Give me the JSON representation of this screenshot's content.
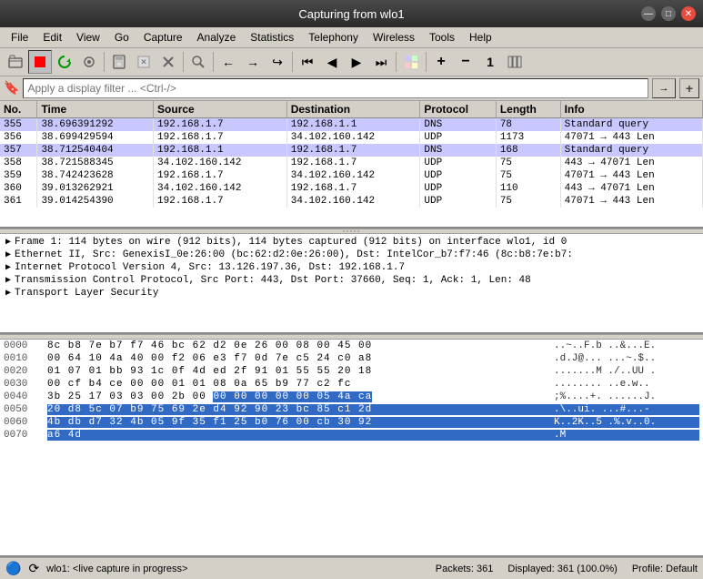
{
  "titlebar": {
    "title": "Capturing from wlo1",
    "min_label": "—",
    "max_label": "□",
    "close_label": "✕"
  },
  "menubar": {
    "items": [
      {
        "label": "File",
        "id": "file"
      },
      {
        "label": "Edit",
        "id": "edit"
      },
      {
        "label": "View",
        "id": "view"
      },
      {
        "label": "Go",
        "id": "go"
      },
      {
        "label": "Capture",
        "id": "capture"
      },
      {
        "label": "Analyze",
        "id": "analyze"
      },
      {
        "label": "Statistics",
        "id": "statistics"
      },
      {
        "label": "Telephony",
        "id": "telephony"
      },
      {
        "label": "Wireless",
        "id": "wireless"
      },
      {
        "label": "Tools",
        "id": "tools"
      },
      {
        "label": "Help",
        "id": "help"
      }
    ]
  },
  "toolbar": {
    "buttons": [
      {
        "id": "open",
        "icon": "📂",
        "tooltip": "Open"
      },
      {
        "id": "stop",
        "icon": "⏹",
        "tooltip": "Stop",
        "color": "red"
      },
      {
        "id": "restart",
        "icon": "🔄",
        "tooltip": "Restart"
      },
      {
        "id": "options",
        "icon": "⚙",
        "tooltip": "Options"
      },
      {
        "id": "save",
        "icon": "💾",
        "tooltip": "Save"
      },
      {
        "id": "close",
        "icon": "📋",
        "tooltip": "Close"
      },
      {
        "id": "export",
        "icon": "✖",
        "tooltip": "Export"
      },
      {
        "id": "find",
        "icon": "🔍",
        "tooltip": "Find"
      },
      {
        "id": "back",
        "icon": "←",
        "tooltip": "Back"
      },
      {
        "id": "forward",
        "icon": "→",
        "tooltip": "Forward"
      },
      {
        "id": "jump",
        "icon": "↪",
        "tooltip": "Jump"
      },
      {
        "id": "first",
        "icon": "⏮",
        "tooltip": "First"
      },
      {
        "id": "prev",
        "icon": "◀",
        "tooltip": "Previous"
      },
      {
        "id": "next",
        "icon": "▶",
        "tooltip": "Next"
      },
      {
        "id": "last",
        "icon": "⏭",
        "tooltip": "Last"
      },
      {
        "id": "colorize",
        "icon": "🎨",
        "tooltip": "Colorize"
      },
      {
        "id": "zoom-in",
        "icon": "➕",
        "tooltip": "Zoom In"
      },
      {
        "id": "zoom-out",
        "icon": "➖",
        "tooltip": "Zoom Out"
      },
      {
        "id": "normal",
        "icon": "1",
        "tooltip": "Normal Size"
      },
      {
        "id": "resize",
        "icon": "⊞",
        "tooltip": "Resize"
      }
    ]
  },
  "filterbar": {
    "placeholder": "Apply a display filter ... <Ctrl-/>",
    "apply_label": "→",
    "add_label": "+"
  },
  "packet_table": {
    "columns": [
      "No.",
      "Time",
      "Source",
      "Destination",
      "Protocol",
      "Length",
      "Info"
    ],
    "rows": [
      {
        "no": "355",
        "time": "38.696391292",
        "source": "192.168.1.7",
        "dest": "192.168.1.1",
        "protocol": "DNS",
        "length": "78",
        "info": "Standard query",
        "type": "dns"
      },
      {
        "no": "356",
        "time": "38.699429594",
        "source": "192.168.1.7",
        "dest": "34.102.160.142",
        "protocol": "UDP",
        "length": "1173",
        "info": "47071 → 443 Len",
        "type": "udp"
      },
      {
        "no": "357",
        "time": "38.712540404",
        "source": "192.168.1.1",
        "dest": "192.168.1.7",
        "protocol": "DNS",
        "length": "168",
        "info": "Standard query",
        "type": "dns"
      },
      {
        "no": "358",
        "time": "38.721588345",
        "source": "34.102.160.142",
        "dest": "192.168.1.7",
        "protocol": "UDP",
        "length": "75",
        "info": "443 → 47071 Len",
        "type": "udp"
      },
      {
        "no": "359",
        "time": "38.742423628",
        "source": "192.168.1.7",
        "dest": "34.102.160.142",
        "protocol": "UDP",
        "length": "75",
        "info": "47071 → 443 Len",
        "type": "udp"
      },
      {
        "no": "360",
        "time": "39.013262921",
        "source": "34.102.160.142",
        "dest": "192.168.1.7",
        "protocol": "UDP",
        "length": "110",
        "info": "443 → 47071 Len",
        "type": "udp"
      },
      {
        "no": "361",
        "time": "39.014254390",
        "source": "192.168.1.7",
        "dest": "34.102.160.142",
        "protocol": "UDP",
        "length": "75",
        "info": "47071 → 443 Len",
        "type": "udp"
      }
    ]
  },
  "packet_details": {
    "items": [
      {
        "text": "Frame 1: 114 bytes on wire (912 bits), 114 bytes captured (912 bits) on interface wlo1, id 0",
        "expanded": false
      },
      {
        "text": "Ethernet II, Src: GenexisI_0e:26:00 (bc:62:d2:0e:26:00), Dst: IntelCor_b7:f7:46 (8c:b8:7e:b7:",
        "expanded": false
      },
      {
        "text": "Internet Protocol Version 4, Src: 13.126.197.36, Dst: 192.168.1.7",
        "expanded": false
      },
      {
        "text": "Transmission Control Protocol, Src Port: 443, Dst Port: 37660, Seq: 1, Ack: 1, Len: 48",
        "expanded": false
      },
      {
        "text": "Transport Layer Security",
        "expanded": false
      }
    ]
  },
  "hex_dump": {
    "rows": [
      {
        "offset": "0000",
        "bytes": "8c b8 7e b7 f7 46 bc 62  d2 0e 26 00 08 00 45 00",
        "ascii": "..~..F.b ..&...E."
      },
      {
        "offset": "0010",
        "bytes": "00 64 10 4a 40 00 f2 06  e3 f7 0d 7e c5 24 c0 a8",
        "ascii": ".d.J@... ...~.$.."
      },
      {
        "offset": "0020",
        "bytes": "01 07 01 bb 93 1c 0f 4d  ed 2f 91 01 55 55 20 18",
        "ascii": ".......M ./..UU ."
      },
      {
        "offset": "0030",
        "bytes": "00 cf b4 ce 00 00 01 01  08 0a 65 b9 77 c2 fc",
        "ascii": "........ ..e.w.."
      },
      {
        "offset": "0040",
        "bytes": "3b 25 17 03 03 00 2b 00  00 00 00 00 00 05 4a ca",
        "ascii": ";%....+. ......J.",
        "highlight_bytes": "00 00 00 00 00 05 4a ca",
        "highlight_start": 8
      },
      {
        "offset": "0050",
        "bytes": "20 d8 5c 07 b9 75 69 2e  d4 92 90 23 bc 85 c1 2d",
        "ascii": " .\\..ui. ...#...-",
        "highlight": true
      },
      {
        "offset": "0060",
        "bytes": "4b db d7 32 4b 05 9f 35  f1 25 b0 76 00 cb 30 92",
        "ascii": "K..2K..5 .%.v..0.",
        "highlight": true
      },
      {
        "offset": "0070",
        "bytes": "a6 4d",
        "ascii": ".M",
        "highlight": true
      }
    ]
  },
  "statusbar": {
    "capture_text": "wlo1: <live capture in progress>",
    "packets_text": "Packets: 361",
    "displayed_text": "Displayed: 361 (100.0%)",
    "profile_text": "Profile: Default"
  }
}
